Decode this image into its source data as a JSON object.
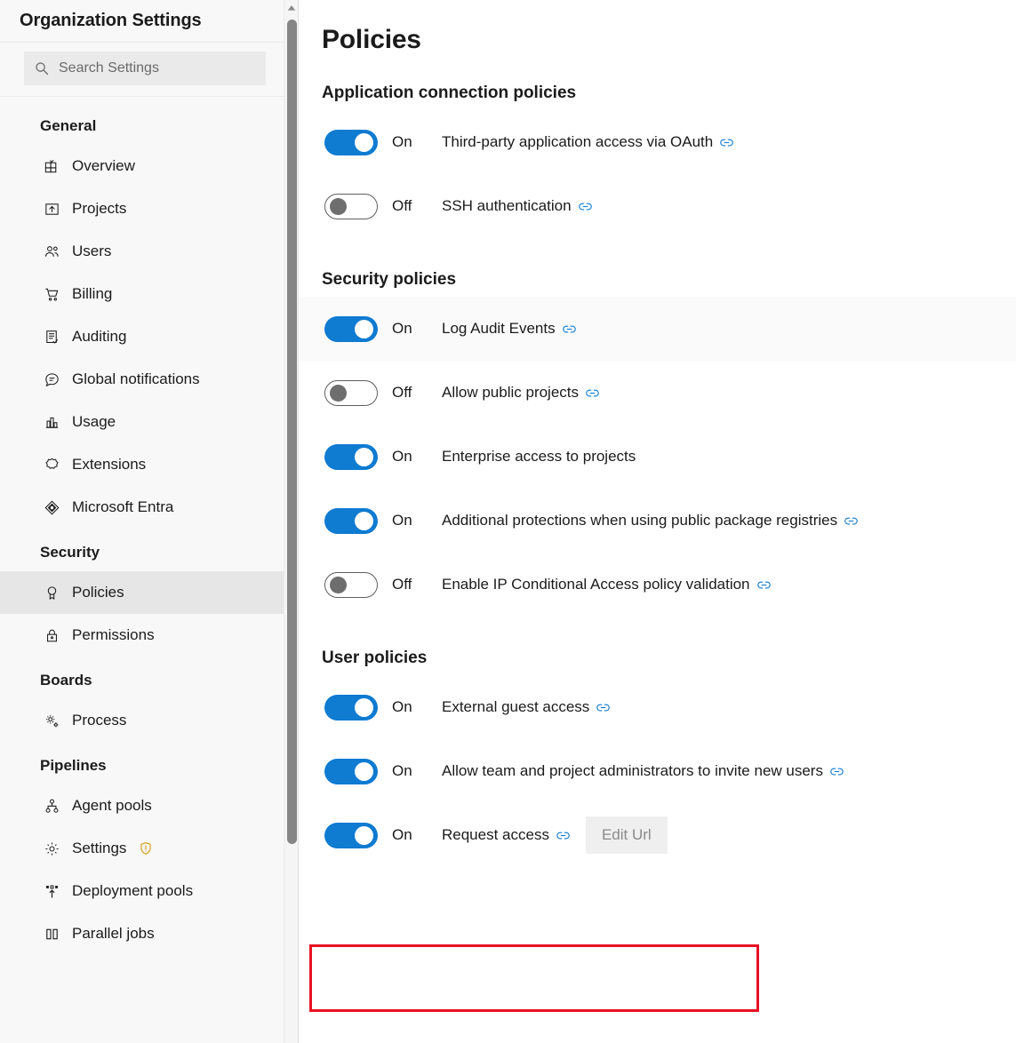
{
  "sidebar": {
    "title": "Organization Settings",
    "search": {
      "placeholder": "Search Settings",
      "value": "",
      "icon": "search-icon"
    },
    "groups": [
      {
        "title": "General",
        "items": [
          {
            "label": "Overview",
            "icon": "overview-icon",
            "selected": false
          },
          {
            "label": "Projects",
            "icon": "projects-icon",
            "selected": false
          },
          {
            "label": "Users",
            "icon": "users-icon",
            "selected": false
          },
          {
            "label": "Billing",
            "icon": "billing-cart-icon",
            "selected": false
          },
          {
            "label": "Auditing",
            "icon": "auditing-icon",
            "selected": false
          },
          {
            "label": "Global notifications",
            "icon": "notifications-icon",
            "selected": false
          },
          {
            "label": "Usage",
            "icon": "usage-chart-icon",
            "selected": false
          },
          {
            "label": "Extensions",
            "icon": "extensions-icon",
            "selected": false
          },
          {
            "label": "Microsoft Entra",
            "icon": "microsoft-entra-icon",
            "selected": false
          }
        ]
      },
      {
        "title": "Security",
        "items": [
          {
            "label": "Policies",
            "icon": "policies-ribbon-icon",
            "selected": true
          },
          {
            "label": "Permissions",
            "icon": "lock-icon",
            "selected": false
          }
        ]
      },
      {
        "title": "Boards",
        "items": [
          {
            "label": "Process",
            "icon": "process-gear-icon",
            "selected": false
          }
        ]
      },
      {
        "title": "Pipelines",
        "items": [
          {
            "label": "Agent pools",
            "icon": "agent-pools-icon",
            "selected": false
          },
          {
            "label": "Settings",
            "icon": "gear-icon",
            "selected": false,
            "warning": "warning-shield-icon"
          },
          {
            "label": "Deployment pools",
            "icon": "deployment-pools-icon",
            "selected": false
          },
          {
            "label": "Parallel jobs",
            "icon": "parallel-jobs-icon",
            "selected": false
          }
        ]
      }
    ],
    "scrollbar": {
      "up_arrow": "scroll-up-arrow-icon"
    }
  },
  "main": {
    "page_title": "Policies",
    "sections": [
      {
        "id": "application-connection-policies",
        "title": "Application connection policies",
        "rows": [
          {
            "state": "On",
            "on": true,
            "label": "Third-party application access via OAuth",
            "link": true,
            "hovered": false
          },
          {
            "state": "Off",
            "on": false,
            "label": "SSH authentication",
            "link": true,
            "hovered": false
          }
        ]
      },
      {
        "id": "security-policies",
        "title": "Security policies",
        "rows": [
          {
            "state": "On",
            "on": true,
            "label": "Log Audit Events",
            "link": true,
            "hovered": true
          },
          {
            "state": "Off",
            "on": false,
            "label": "Allow public projects",
            "link": true,
            "hovered": false
          },
          {
            "state": "On",
            "on": true,
            "label": "Enterprise access to projects",
            "link": false,
            "hovered": false
          },
          {
            "state": "On",
            "on": true,
            "label": "Additional protections when using public package registries",
            "link": true,
            "hovered": false
          },
          {
            "state": "Off",
            "on": false,
            "label": "Enable IP Conditional Access policy validation",
            "link": true,
            "hovered": false
          }
        ]
      },
      {
        "id": "user-policies",
        "title": "User policies",
        "rows": [
          {
            "state": "On",
            "on": true,
            "label": "External guest access",
            "link": true,
            "hovered": false
          },
          {
            "state": "On",
            "on": true,
            "label": "Allow team and project administrators to invite new users",
            "link": true,
            "hovered": false
          },
          {
            "state": "On",
            "on": true,
            "label": "Request access",
            "link": true,
            "hovered": false,
            "button": "Edit Url",
            "highlighted": true
          }
        ]
      }
    ]
  },
  "colors": {
    "toggle_on": "#0f7bd1",
    "highlight_border": "#e81123",
    "link_icon": "#0f7bd1",
    "selected_nav": "#e6e6e6",
    "warning_shield": "#d9a227"
  }
}
